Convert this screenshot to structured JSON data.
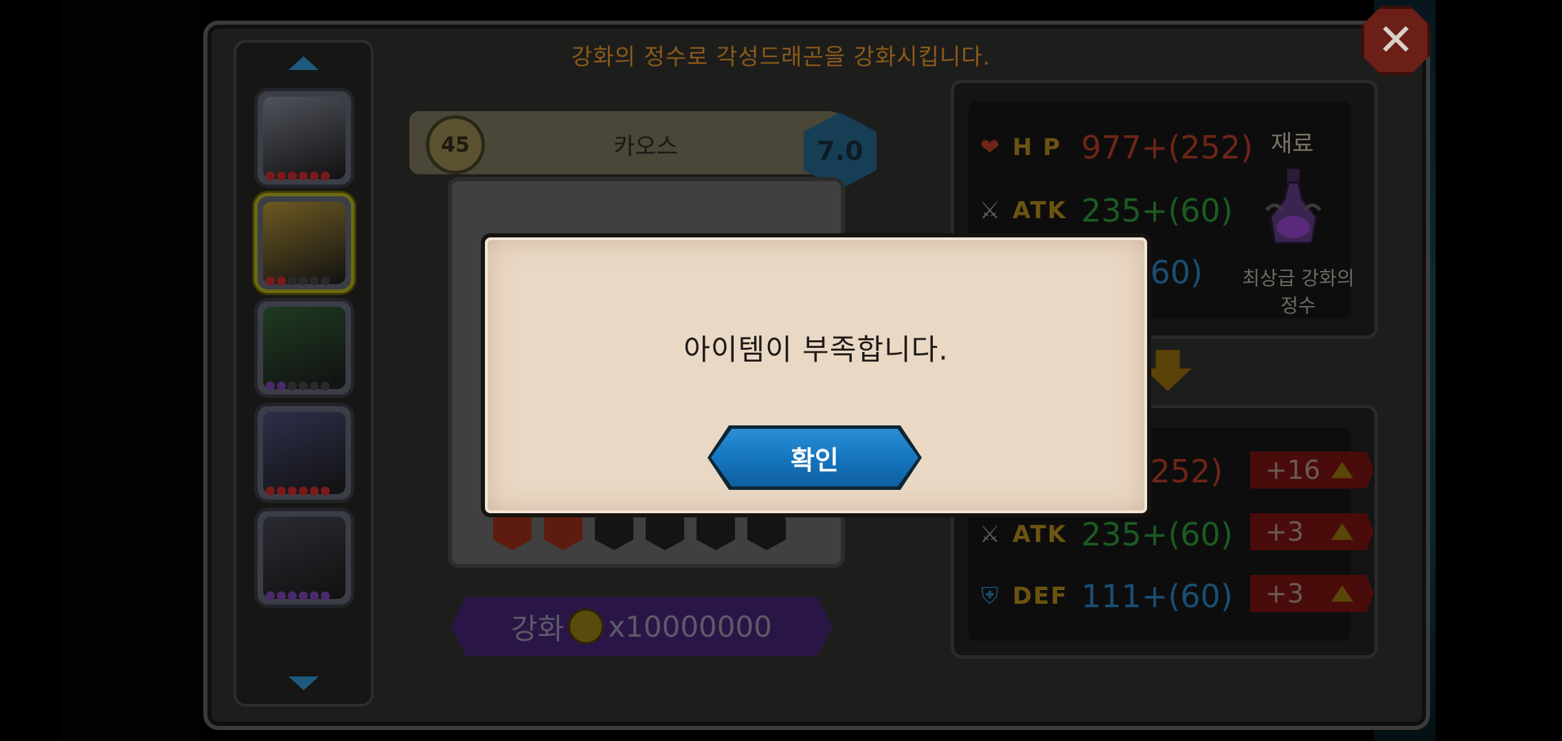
{
  "header": {
    "title": "강화의 정수로 각성드래곤을 강화시킵니다."
  },
  "close_icon": "close-icon",
  "dragon_list": {
    "items": [
      {
        "name": "dragon-slot-1",
        "art_color": "#50535c",
        "stars": [
          "#7a1a1a",
          "#7a1a1a",
          "#7a1a1a",
          "#7a1a1a",
          "#7a1a1a",
          "#7a1a1a"
        ]
      },
      {
        "name": "dragon-slot-2",
        "art_color": "#6d5a22",
        "stars": [
          "#7a1a1a",
          "#7a1a1a",
          "#2a2a2a",
          "#2a2a2a",
          "#2a2a2a",
          "#2a2a2a"
        ],
        "selected": true
      },
      {
        "name": "dragon-slot-3",
        "art_color": "#1f3a22",
        "stars": [
          "#4a2a6a",
          "#4a2a6a",
          "#2a2a2a",
          "#2a2a2a",
          "#2a2a2a",
          "#2a2a2a"
        ]
      },
      {
        "name": "dragon-slot-4",
        "art_color": "#2d2f4a",
        "stars": [
          "#7a1a1a",
          "#7a1a1a",
          "#7a1a1a",
          "#7a1a1a",
          "#7a1a1a",
          "#7a1a1a"
        ]
      },
      {
        "name": "dragon-slot-5",
        "art_color": "#2a2a32",
        "stars": [
          "#4a2a6a",
          "#4a2a6a",
          "#4a2a6a",
          "#4a2a6a",
          "#4a2a6a",
          "#4a2a6a"
        ]
      }
    ]
  },
  "dragon": {
    "level": "45",
    "name": "카오스",
    "grade": "7.0",
    "gems": [
      true,
      true,
      false,
      false,
      false,
      false
    ]
  },
  "enhance": {
    "label": "강화",
    "cost": "x10000000"
  },
  "current_stats": {
    "hp_label": "H P",
    "hp_value": "977+(252)",
    "atk_label": "ATK",
    "atk_value": "235+(60)",
    "def_value": "+(60)"
  },
  "material": {
    "title": "재료",
    "name_line1": "최상급 강화의",
    "name_line2": "정수"
  },
  "next_stats": {
    "hp_value": "+(252)",
    "hp_increase": "+16",
    "atk_label": "ATK",
    "atk_value": "235+(60)",
    "atk_increase": "+3",
    "def_label": "DEF",
    "def_value": "111+(60)",
    "def_increase": "+3"
  },
  "dialog": {
    "message": "아이템이 부족합니다.",
    "ok_label": "확인"
  },
  "colors": {
    "ok_button": "#1473bd",
    "dialog_bg": "#e9d8c4",
    "header_text": "#8c5a1a"
  }
}
